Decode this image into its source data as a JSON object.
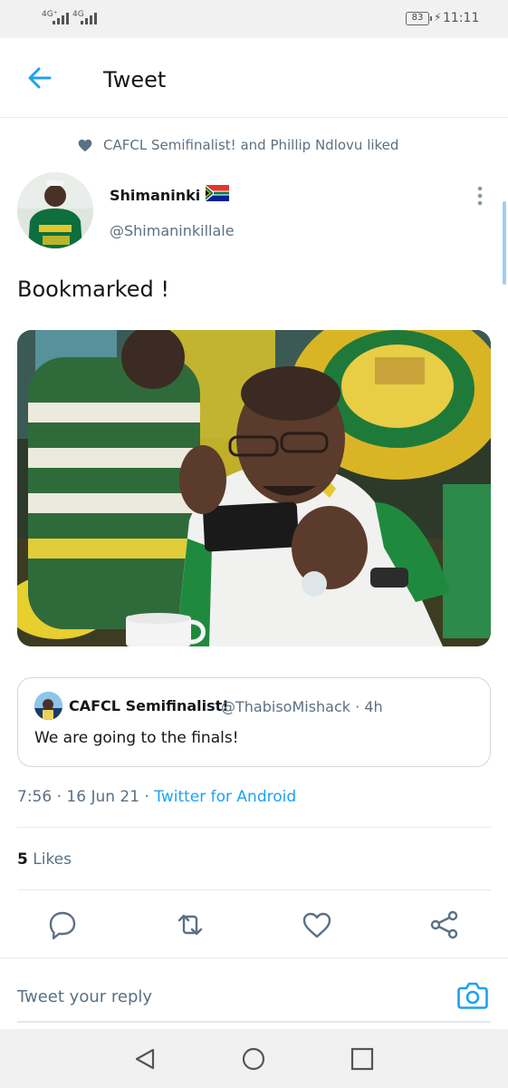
{
  "status_bar": {
    "sim1": "4G⁺",
    "sim2": "4G",
    "battery": "83",
    "time": "11:11"
  },
  "header": {
    "title": "Tweet",
    "back_icon": "arrow-left-icon"
  },
  "social_context": {
    "text": "CAFCL Semifinalist! and Phillip Ndlovu liked",
    "icon": "heart-filled-icon"
  },
  "author": {
    "name": "Shimaninki",
    "flag": "🇿🇦",
    "handle": "@Shimaninkillale"
  },
  "tweet": {
    "text": "Bookmarked !"
  },
  "quote": {
    "name": "CAFCL Semifinalist!",
    "handle": "@ThabisoMishack",
    "separator": "·",
    "age": "4h",
    "text": "We are going to the finals!"
  },
  "meta": {
    "time": "7:56",
    "separator": "·",
    "date": "16 Jun 21",
    "source": "Twitter for Android"
  },
  "stats": {
    "likes_count": "5",
    "likes_label": " Likes"
  },
  "reply": {
    "placeholder": "Tweet your reply"
  },
  "colors": {
    "accent": "#1da1f2",
    "secondary_text": "#5b7083",
    "divider": "#e6ecf0"
  }
}
